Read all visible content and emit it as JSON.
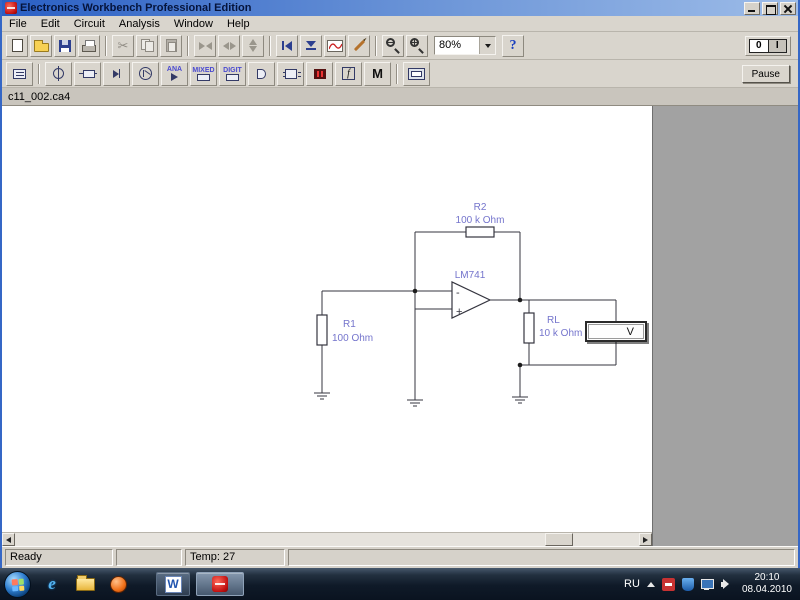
{
  "window": {
    "title": "Electronics Workbench Professional Edition"
  },
  "menu": {
    "items": [
      {
        "label": "File"
      },
      {
        "label": "Edit"
      },
      {
        "label": "Circuit"
      },
      {
        "label": "Analysis"
      },
      {
        "label": "Window"
      },
      {
        "label": "Help"
      }
    ]
  },
  "toolbar": {
    "cut_glyph": "✂",
    "zoom_value": "80%",
    "help_label": "?",
    "power_off_label": "0",
    "power_on_label": "I",
    "pause_label": "Pause"
  },
  "palette": {
    "ana_label": "ANA",
    "mixed_label": "MIXED",
    "digit_label": "DIGIT",
    "controls_label": "f",
    "misc_label": "M"
  },
  "document": {
    "tab_title": "c11_002.ca4"
  },
  "circuit": {
    "r2": {
      "ref": "R2",
      "value": "100 k Ohm"
    },
    "r1": {
      "ref": "R1",
      "value": "100 Ohm"
    },
    "rl": {
      "ref": "RL",
      "value": "10 k Ohm"
    },
    "opamp": {
      "ref": "LM741",
      "minus_label": "-",
      "plus_label": "+"
    },
    "voltmeter": {
      "unit": "V"
    }
  },
  "statusbar": {
    "ready": "Ready",
    "temp": "Temp: 27"
  },
  "taskbar": {
    "icons": {
      "ie": "e",
      "word": "W"
    },
    "tray": {
      "lang": "RU",
      "time": "20:10",
      "date": "08.04.2010"
    }
  },
  "colors": {
    "titlebar_blue": "#2a5fc4",
    "label_blue": "#7474cc",
    "wire": "#35353f",
    "icon_navy": "#2c3f8f"
  }
}
